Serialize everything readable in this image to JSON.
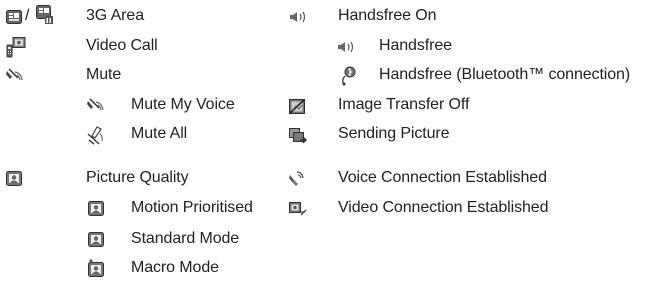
{
  "left_column": [
    {
      "name": "3g-area",
      "label": "3G Area",
      "icons": [
        "3g-area-icon",
        "3g-area-alt-icon"
      ],
      "separator": "/"
    },
    {
      "name": "video-call",
      "label": "Video Call",
      "icons": [
        "video-call-icon"
      ]
    },
    {
      "name": "mute",
      "label": "Mute",
      "icons": [
        "mute-icon"
      ]
    },
    {
      "name": "mute-my-voice",
      "label": "Mute My Voice",
      "icons": [
        "mute-my-voice-icon"
      ]
    },
    {
      "name": "mute-all",
      "label": "Mute All",
      "icons": [
        "mute-all-icon"
      ]
    },
    {
      "name": "picture-quality",
      "label": "Picture Quality",
      "icons": [
        "picture-quality-icon"
      ]
    },
    {
      "name": "motion-prioritised",
      "label": "Motion Prioritised",
      "icons": [
        "motion-prioritised-icon"
      ]
    },
    {
      "name": "standard-mode",
      "label": "Standard Mode",
      "icons": [
        "standard-mode-icon"
      ]
    },
    {
      "name": "macro-mode",
      "label": "Macro Mode",
      "icons": [
        "macro-mode-icon"
      ]
    }
  ],
  "right_column": [
    {
      "name": "handsfree-on",
      "label": "Handsfree On",
      "icons": [
        "speaker-icon"
      ]
    },
    {
      "name": "handsfree",
      "label": "Handsfree",
      "icons": [
        "speaker-icon"
      ]
    },
    {
      "name": "handsfree-bluetooth",
      "label": "Handsfree (Bluetooth™ connection)",
      "icons": [
        "bluetooth-headset-icon"
      ]
    },
    {
      "name": "image-transfer-off",
      "label": "Image Transfer Off",
      "icons": [
        "image-transfer-off-icon"
      ]
    },
    {
      "name": "sending-picture",
      "label": "Sending Picture",
      "icons": [
        "sending-picture-icon"
      ]
    },
    {
      "name": "voice-connection",
      "label": "Voice Connection Established",
      "icons": [
        "voice-connection-icon"
      ]
    },
    {
      "name": "video-connection",
      "label": "Video Connection Established",
      "icons": [
        "video-connection-icon"
      ]
    }
  ]
}
